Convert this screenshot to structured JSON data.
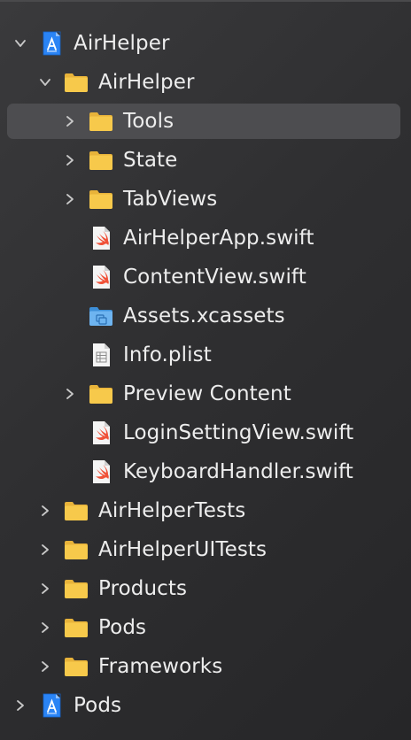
{
  "navigator": {
    "items": [
      {
        "label": "AirHelper",
        "icon": "xcode-project-icon",
        "expanded": true
      },
      {
        "label": "AirHelper",
        "icon": "folder-icon",
        "expanded": true
      },
      {
        "label": "Tools",
        "icon": "folder-icon",
        "expanded": false,
        "selected": true
      },
      {
        "label": "State",
        "icon": "folder-icon",
        "expanded": false
      },
      {
        "label": "TabViews",
        "icon": "folder-icon",
        "expanded": false
      },
      {
        "label": "AirHelperApp.swift",
        "icon": "swift-file-icon"
      },
      {
        "label": "ContentView.swift",
        "icon": "swift-file-icon"
      },
      {
        "label": "Assets.xcassets",
        "icon": "asset-catalog-icon"
      },
      {
        "label": "Info.plist",
        "icon": "plist-file-icon"
      },
      {
        "label": "Preview Content",
        "icon": "folder-icon",
        "expanded": false
      },
      {
        "label": "LoginSettingView.swift",
        "icon": "swift-file-icon"
      },
      {
        "label": "KeyboardHandler.swift",
        "icon": "swift-file-icon"
      },
      {
        "label": "AirHelperTests",
        "icon": "folder-icon",
        "expanded": false
      },
      {
        "label": "AirHelperUITests",
        "icon": "folder-icon",
        "expanded": false
      },
      {
        "label": "Products",
        "icon": "folder-icon",
        "expanded": false
      },
      {
        "label": "Pods",
        "icon": "folder-icon",
        "expanded": false
      },
      {
        "label": "Frameworks",
        "icon": "folder-icon",
        "expanded": false
      },
      {
        "label": "Pods",
        "icon": "xcode-project-icon",
        "expanded": false
      }
    ]
  },
  "colors": {
    "background": "#2f2f31",
    "selection": "#4d4d50",
    "folder": "#f5c242",
    "swift": "#f05138",
    "project": "#1f7cf2",
    "text": "#ededed"
  }
}
